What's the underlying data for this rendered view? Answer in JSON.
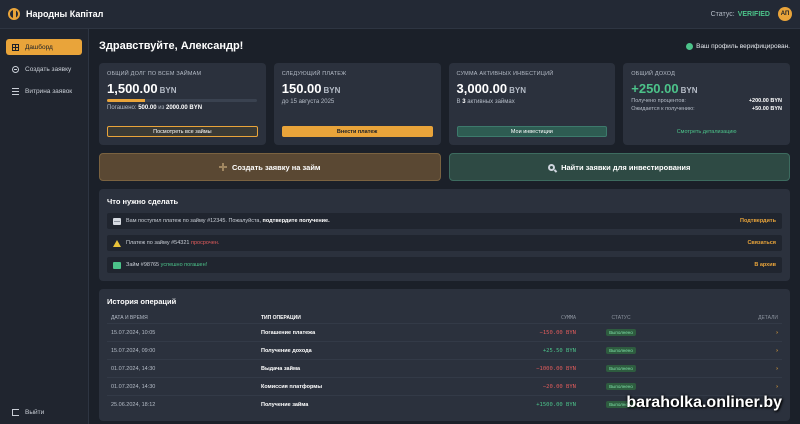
{
  "app": {
    "brand": "Народны Капітал"
  },
  "topbar": {
    "status_label": "Статус:",
    "status_value": "VERIFIED",
    "avatar_initials": "АП"
  },
  "sidebar": {
    "items": [
      {
        "label": "Дашборд",
        "icon": "grid-icon",
        "active": true
      },
      {
        "label": "Создать заявку",
        "icon": "plus-circle-icon",
        "active": false
      },
      {
        "label": "Витрина заявок",
        "icon": "list-icon",
        "active": false
      }
    ],
    "logout": "Выйти"
  },
  "header": {
    "greeting": "Здравствуйте, Александр!",
    "verified": "Ваш профиль верифицирован."
  },
  "cards": {
    "debt": {
      "title": "Общий долг по всем займам",
      "value": "1,500.00",
      "currency": "BYN",
      "progress": 0.25,
      "sub_prefix": "Погашено:",
      "paid": "500.00",
      "sub_mid": "из",
      "total": "2000.00 BYN",
      "button": "Посмотреть все займы"
    },
    "payment": {
      "title": "Следующий платеж",
      "value": "150.00",
      "currency": "BYN",
      "sub": "до 15 августа 2025",
      "button": "Внести платеж"
    },
    "invest": {
      "title": "Сумма активных инвестиций",
      "value": "3,000.00",
      "currency": "BYN",
      "sub_prefix": "В",
      "count": "3",
      "sub_suffix": "активных займах",
      "button": "Мои инвестиции"
    },
    "income": {
      "title": "Общий доход",
      "value": "+250.00",
      "currency": "BYN",
      "row1_label": "Получено процентов:",
      "row1_value": "+200.00 BYN",
      "row2_label": "Ожидается к получению:",
      "row2_value": "+50.00 BYN",
      "link": "Смотреть детализацию"
    }
  },
  "actions": {
    "create": "Создать заявку на займ",
    "find": "Найти заявки для инвестирования"
  },
  "todo": {
    "title": "Что нужно сделать",
    "items": [
      {
        "text": "Вам поступил платеж по займу #12345. Пожалуйста,",
        "strong": "подтвердите получение.",
        "action": "Подтвердить"
      },
      {
        "text": "Платеж по займу #54321",
        "strong": "просрочен.",
        "action": "Связаться"
      },
      {
        "text": "Займ #98765",
        "strong": "успешно погашен!",
        "action": "В архив"
      }
    ]
  },
  "history": {
    "title": "История операций",
    "columns": {
      "date": "Дата и время",
      "type": "Тип операции",
      "sum": "Сумма",
      "status": "Статус",
      "details": "Детали"
    },
    "rows": [
      {
        "date": "15.07.2024, 10:05",
        "type": "Погашение платежа",
        "sum": "−150.00 BYN",
        "status": "Выполнено",
        "sign": "neg"
      },
      {
        "date": "15.07.2024, 09:00",
        "type": "Получение дохода",
        "sum": "+25.50 BYN",
        "status": "Выполнено",
        "sign": "pos"
      },
      {
        "date": "01.07.2024, 14:30",
        "type": "Выдача займа",
        "sum": "−1000.00 BYN",
        "status": "Выполнено",
        "sign": "neg"
      },
      {
        "date": "01.07.2024, 14:30",
        "type": "Комиссия платформы",
        "sum": "−20.00 BYN",
        "status": "Выполнено",
        "sign": "neg"
      },
      {
        "date": "25.06.2024, 18:12",
        "type": "Получение займа",
        "sum": "+1500.00 BYN",
        "status": "Выполнено",
        "sign": "pos"
      }
    ]
  },
  "watermark": "baraholka.onliner.by",
  "colors": {
    "accent": "#e9a43a",
    "success": "#4cc38a",
    "danger": "#e25c5c",
    "background": "#1b2029",
    "card": "#2b313d"
  }
}
